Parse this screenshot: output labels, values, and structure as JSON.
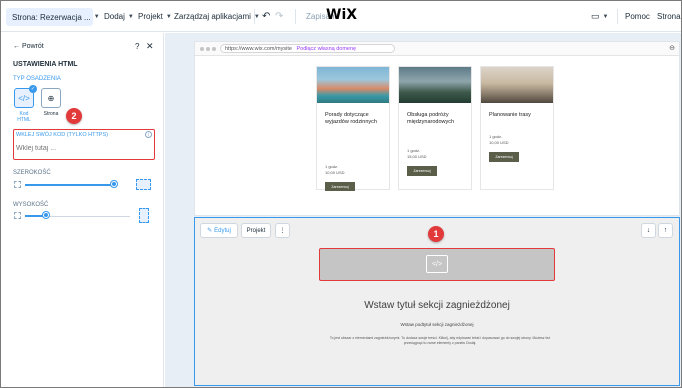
{
  "topbar": {
    "page_select": "Strona: Rezerwacja ...",
    "menu_add": "Dodaj",
    "menu_project": "Projekt",
    "menu_apps": "Zarządzaj aplikacjami",
    "status": "Zapisane",
    "logo": "WiX",
    "help": "Pomoc",
    "page_cut": "Strona"
  },
  "panel": {
    "back": "← Powrót",
    "help_icon": "?",
    "close_icon": "✕",
    "title": "USTAWIENIA HTML",
    "embed_type_label": "TYP OSADZENIA",
    "embed_code_label": "Kod HTML",
    "embed_page_label": "Strona",
    "code_section_label": "WKLEJ SWÓJ KOD (TYLKO HTTPS)",
    "code_placeholder": "Wklej tutaj ...",
    "width_label": "SZEROKOŚĆ",
    "height_label": "WYSOKOŚĆ",
    "width_value": 0.85,
    "height_value": 0.2
  },
  "callouts": {
    "one": "1",
    "two": "2"
  },
  "browser": {
    "url": "https://www.wix.com/mysite",
    "url_link": "Podłącz własną domenę",
    "cards": [
      {
        "title": "Porady dotyczące wyjazdów rodzinnych",
        "meta": "1 godz.",
        "price": "10,00 USD",
        "button": "Zarezerwuj"
      },
      {
        "title": "Obsługa podróży międzynarodowych",
        "meta": "1 godz.",
        "price": "15,00 USD",
        "button": "Zarezerwuj"
      },
      {
        "title": "Planowanie trasy",
        "meta": "1 godz.",
        "price": "10,00 USD",
        "button": "Zarezerwuj"
      }
    ]
  },
  "section": {
    "edit_button": "Edytuj",
    "project_button": "Projekt",
    "more_button": "⋮",
    "down_button": "↓",
    "up_button": "↑",
    "title": "Wstaw tytuł sekcji zagnieżdżonej",
    "subtitle": "Wstaw podtytuł sekcji zagnieżdżonej",
    "body": "To jest obszar z elementami zagnieżdżonymi. Tu dodasz swoje treści. Kliknij, aby edytować tekst i dopasować go do swojej strony. Możesz też przeciągnąć tu nowe elementy z panelu Dodaj."
  },
  "colors": {
    "accent": "#3899ec",
    "callout": "#e23a3a",
    "card_button": "#5b5e48"
  }
}
